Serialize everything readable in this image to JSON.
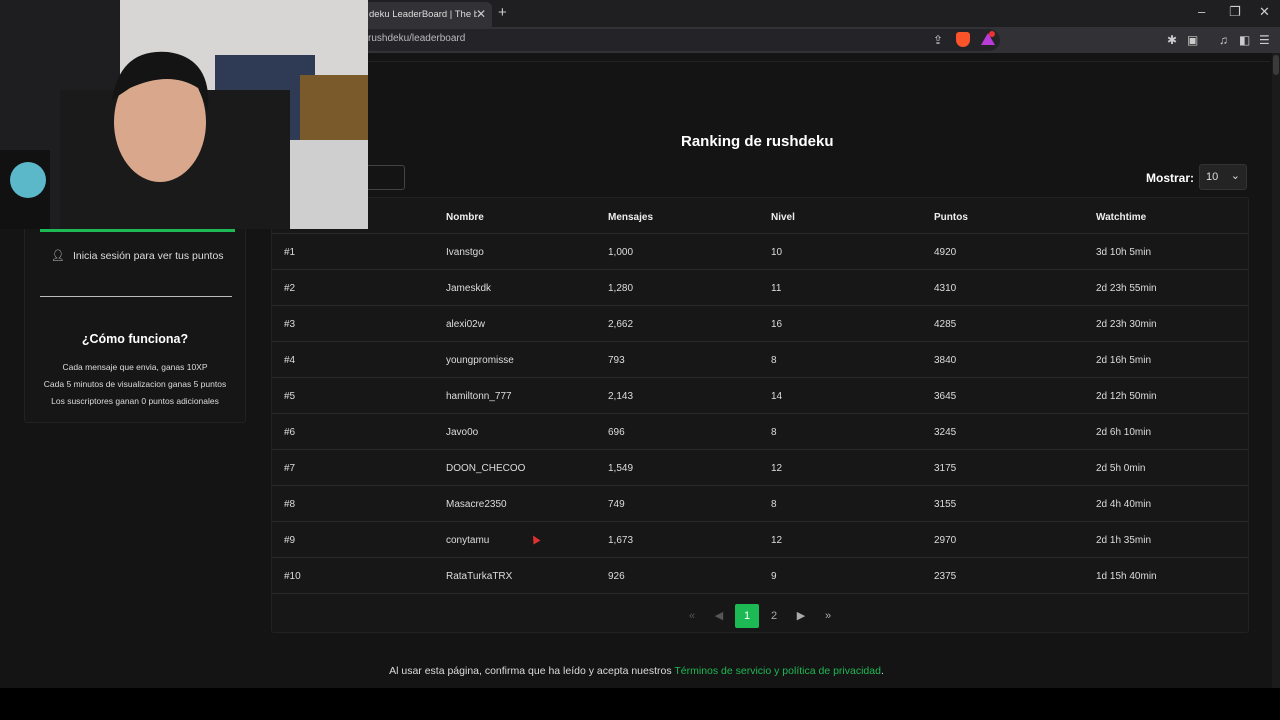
{
  "browser": {
    "tab_title": "deku LeaderBoard | The best",
    "url": "rushdeku/leaderboard"
  },
  "page": {
    "title": "Ranking de rushdeku",
    "show_label": "Mostrar:",
    "show_value": "10"
  },
  "table": {
    "headers": [
      "Nombre",
      "Mensajes",
      "Nivel",
      "Puntos",
      "Watchtime"
    ],
    "rows": [
      {
        "rank": "#1",
        "name": "Ivanstgo",
        "messages": "1,000",
        "level": "10",
        "points": "4920",
        "watchtime": "3d 10h 5min"
      },
      {
        "rank": "#2",
        "name": "Jameskdk",
        "messages": "1,280",
        "level": "11",
        "points": "4310",
        "watchtime": "2d 23h 55min"
      },
      {
        "rank": "#3",
        "name": "alexi02w",
        "messages": "2,662",
        "level": "16",
        "points": "4285",
        "watchtime": "2d 23h 30min"
      },
      {
        "rank": "#4",
        "name": "youngpromisse",
        "messages": "793",
        "level": "8",
        "points": "3840",
        "watchtime": "2d 16h 5min"
      },
      {
        "rank": "#5",
        "name": "hamiltonn_777",
        "messages": "2,143",
        "level": "14",
        "points": "3645",
        "watchtime": "2d 12h 50min"
      },
      {
        "rank": "#6",
        "name": "Javo0o",
        "messages": "696",
        "level": "8",
        "points": "3245",
        "watchtime": "2d 6h 10min"
      },
      {
        "rank": "#7",
        "name": "DOON_CHECOO",
        "messages": "1,549",
        "level": "12",
        "points": "3175",
        "watchtime": "2d 5h 0min"
      },
      {
        "rank": "#8",
        "name": "Masacre2350",
        "messages": "749",
        "level": "8",
        "points": "3155",
        "watchtime": "2d 4h 40min"
      },
      {
        "rank": "#9",
        "name": "conytamu",
        "messages": "1,673",
        "level": "12",
        "points": "2970",
        "watchtime": "2d 1h 35min"
      },
      {
        "rank": "#10",
        "name": "RataTurkaTRX",
        "messages": "926",
        "level": "9",
        "points": "2375",
        "watchtime": "1d 15h 40min"
      }
    ]
  },
  "pagination": {
    "pages": [
      "1",
      "2"
    ],
    "current": "1"
  },
  "sidebar": {
    "login_text": "Inicia sesión para ver tus puntos",
    "how_title": "¿Cómo funciona?",
    "rules": [
      "Cada mensaje que envia, ganas 10XP",
      "Cada 5 minutos de visualizacion ganas 5 puntos",
      "Los suscriptores ganan 0 puntos adicionales"
    ]
  },
  "footer": {
    "text": "Al usar esta página, confirma que ha leído y acepta nuestros",
    "link": "Términos de servicio y política de privacidad",
    "end": "."
  }
}
